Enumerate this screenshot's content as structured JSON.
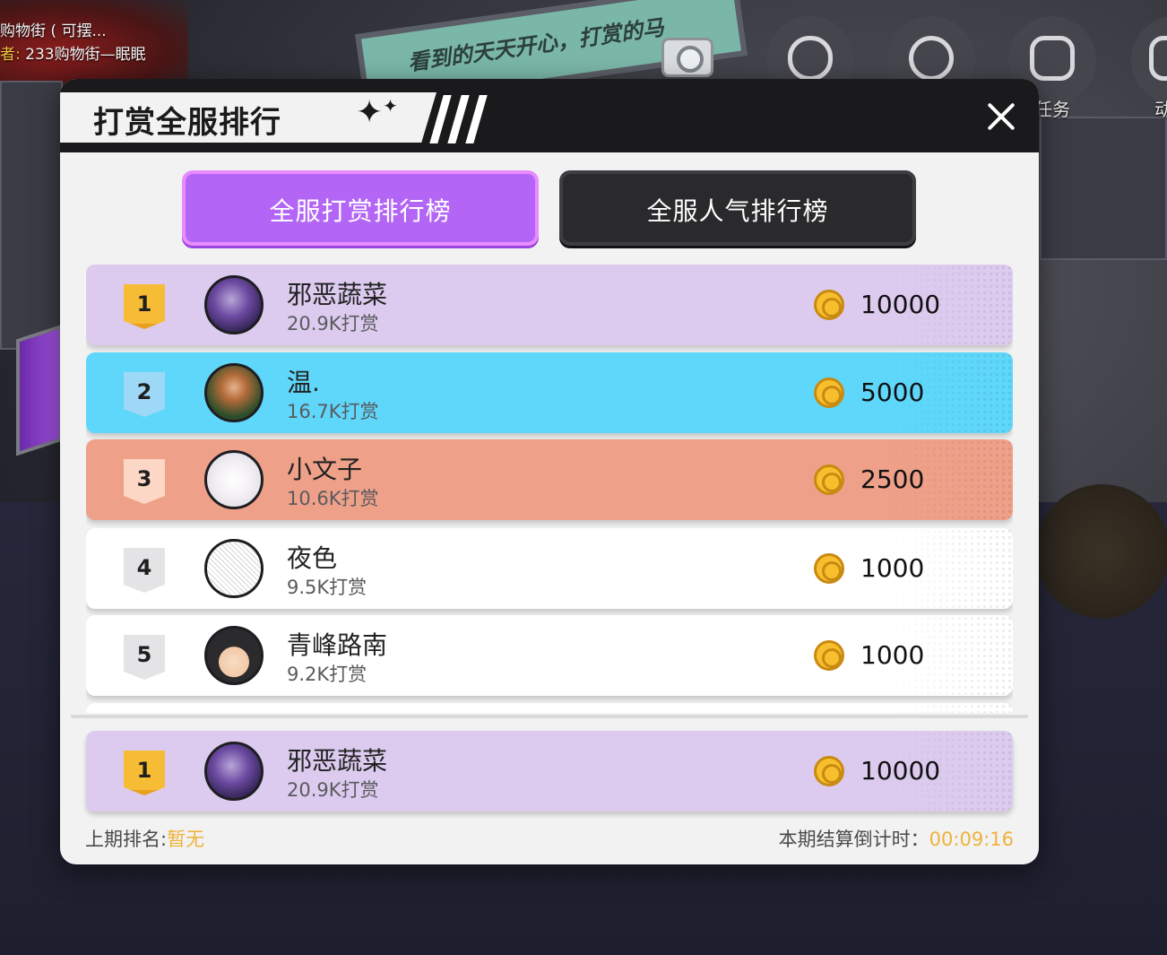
{
  "scene": {
    "top_line1": "购物街 ( 可摆...",
    "top_line2_prefix": "者:",
    "top_line2_text": "233购物街—眠眠",
    "billboard_text": "看到的天天开心，打赏的马",
    "hud_task_label": "任务",
    "hud_partial_label": "动"
  },
  "modal": {
    "title": "打赏全服排行",
    "tabs": [
      {
        "label": "全服打赏排行榜",
        "active": true
      },
      {
        "label": "全服人气排行榜",
        "active": false
      }
    ],
    "rows": [
      {
        "rank": "1",
        "name": "邪恶蔬菜",
        "sub": "20.9K打赏",
        "amount": "10000"
      },
      {
        "rank": "2",
        "name": "温.",
        "sub": "16.7K打赏",
        "amount": "5000"
      },
      {
        "rank": "3",
        "name": "小文子",
        "sub": "10.6K打赏",
        "amount": "2500"
      },
      {
        "rank": "4",
        "name": "夜色",
        "sub": "9.5K打赏",
        "amount": "1000"
      },
      {
        "rank": "5",
        "name": "青峰路南",
        "sub": "9.2K打赏",
        "amount": "1000"
      }
    ],
    "my_rank": {
      "rank": "1",
      "name": "邪恶蔬菜",
      "sub": "20.9K打赏",
      "amount": "10000"
    },
    "footer": {
      "last_rank_label": "上期排名:",
      "last_rank_value": "暂无",
      "countdown_label": "本期结算倒计时：",
      "countdown_value": "00:09:16"
    }
  },
  "colors": {
    "rank1_bg": "#dccbef",
    "rank2_bg": "#5ed7fa",
    "rank3_bg": "#eea088",
    "tab_active": "#b366f5",
    "tab_inactive": "#2a2a2c",
    "accent": "#f0b23a",
    "coin": "#f7bf2d"
  },
  "icons": [
    "close-icon",
    "coin-icon",
    "sparkle-icon",
    "camera-icon",
    "task-icon"
  ]
}
